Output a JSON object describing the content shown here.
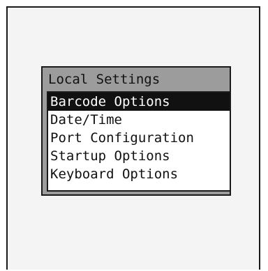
{
  "dialog": {
    "title": "Local Settings",
    "items": [
      {
        "label": "Barcode Options",
        "selected": true
      },
      {
        "label": "Date/Time",
        "selected": false
      },
      {
        "label": "Port Configuration",
        "selected": false
      },
      {
        "label": "Startup Options",
        "selected": false
      },
      {
        "label": "Keyboard Options",
        "selected": false
      }
    ]
  }
}
